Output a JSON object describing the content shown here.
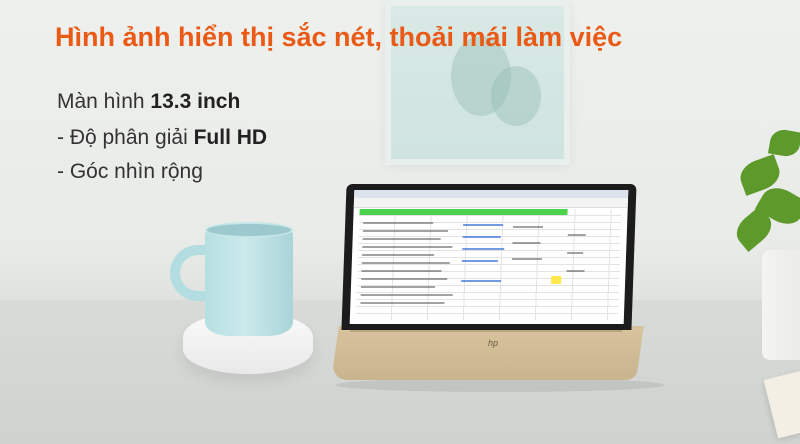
{
  "headline": "Hình ảnh hiển thị sắc nét, thoải mái làm việc",
  "features": [
    {
      "prefix": "Màn hình ",
      "bold": "13.3 inch"
    },
    {
      "prefix": "- Độ phân giải ",
      "bold": "Full HD"
    },
    {
      "prefix": "- Góc nhìn rộng",
      "bold": ""
    }
  ],
  "colors": {
    "headline": "#ea5a16",
    "text": "#333333",
    "sheet_header": "#4bd34b"
  },
  "laptop_logo": "hp"
}
